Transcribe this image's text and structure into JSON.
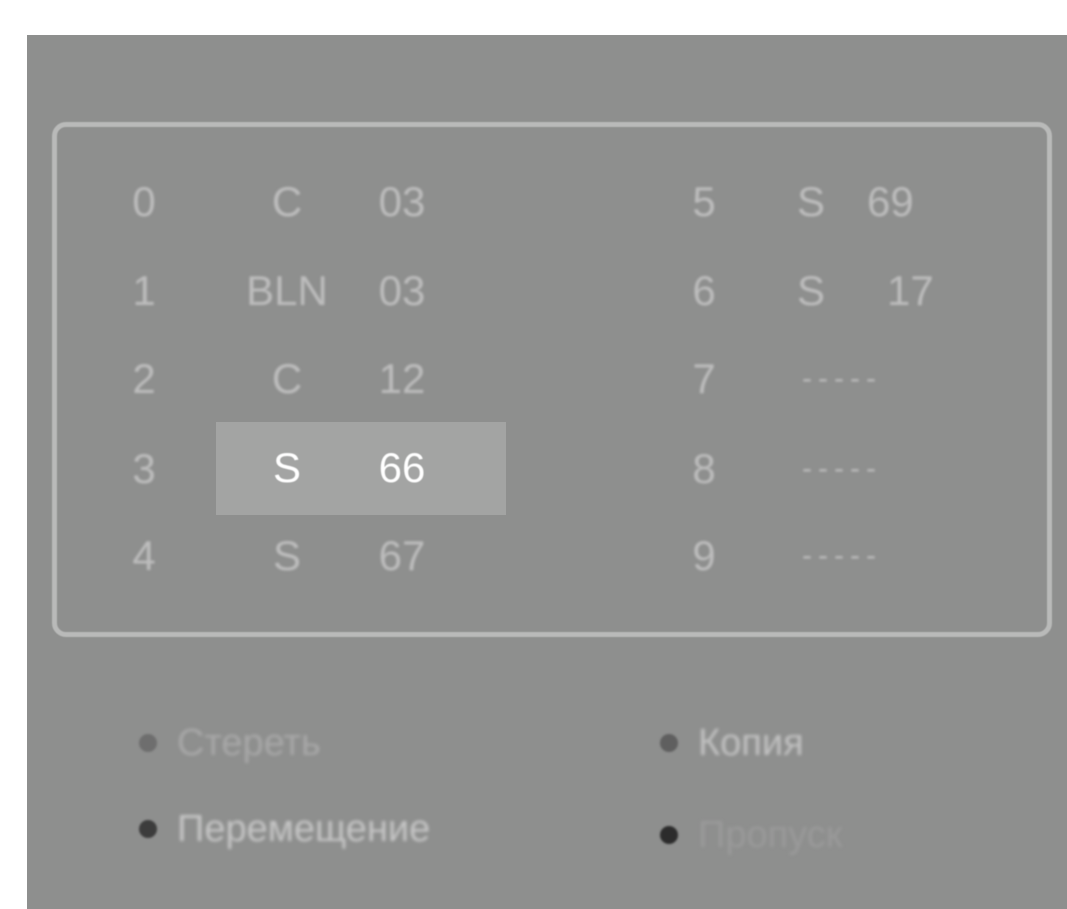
{
  "program_list": {
    "left_column": [
      {
        "num": "0",
        "mode": "C",
        "channel": "03"
      },
      {
        "num": "1",
        "mode": "BLN",
        "channel": "03"
      },
      {
        "num": "2",
        "mode": "C",
        "channel": "12"
      },
      {
        "num": "3",
        "mode": "S",
        "channel": "66"
      },
      {
        "num": "4",
        "mode": "S",
        "channel": "67"
      }
    ],
    "right_column": [
      {
        "num": "5",
        "mode": "S",
        "channel": "69"
      },
      {
        "num": "6",
        "mode": "S",
        "channel": "17"
      },
      {
        "num": "7",
        "mode": "-----",
        "channel": ""
      },
      {
        "num": "8",
        "mode": "-----",
        "channel": ""
      },
      {
        "num": "9",
        "mode": "-----",
        "channel": ""
      }
    ],
    "selected_index": 3
  },
  "legend": {
    "erase": {
      "label": "Стереть",
      "color": "#6e6e6e"
    },
    "copy": {
      "label": "Копия",
      "color": "#5f5f5f"
    },
    "move": {
      "label": "Перемещение",
      "color": "#3c3c3c"
    },
    "skip": {
      "label": "Пропуск",
      "color": "#2c2c2c"
    }
  },
  "colors": {
    "background": "#8e8f8e",
    "frame": "#b9bab9",
    "text": "#bdbdbd",
    "highlight": "#a3a4a3",
    "highlight_text": "#ffffff"
  }
}
